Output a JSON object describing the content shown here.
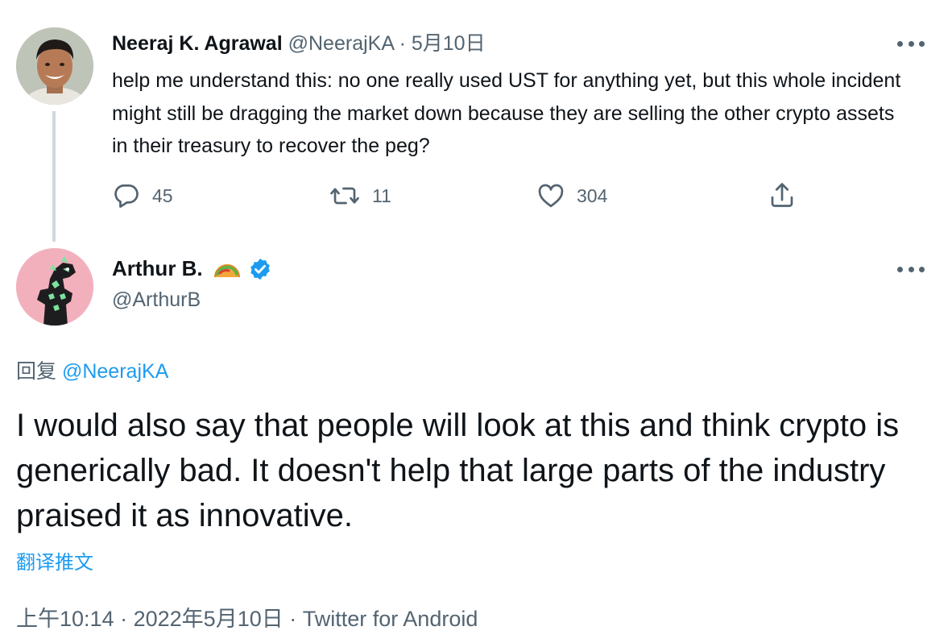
{
  "tweet1": {
    "name": "Neeraj K. Agrawal",
    "handle": "@NeerajKA",
    "separator": "·",
    "date": "5月10日",
    "text": "help me understand this: no one really used UST for anything yet, but this whole incident might still be dragging the market down because they are selling the other crypto assets in their treasury to recover the peg?",
    "reply_count": "45",
    "retweet_count": "11",
    "like_count": "304"
  },
  "tweet2": {
    "name": "Arthur B.",
    "name_emoji": "taco-icon",
    "verified_icon": "verified-badge-icon",
    "handle": "@ArthurB",
    "reply_prefix": "回复",
    "reply_to": "@NeerajKA",
    "text": "I would also say that people will look at this and think crypto is generically bad. It doesn't help that large parts of the industry praised it as innovative.",
    "translate_label": "翻译推文",
    "time": "上午10:14",
    "separator": "·",
    "date": "2022年5月10日",
    "source": "Twitter for Android"
  },
  "icons": {
    "reply": "reply-bubble-icon",
    "retweet": "retweet-icon",
    "like": "heart-icon",
    "share": "share-icon",
    "more": "more-dots-icon"
  },
  "colors": {
    "text": "#0f1419",
    "muted": "#536471",
    "link": "#1d9bf0",
    "thread_line": "#cfd9de",
    "verified": "#1d9bf0"
  }
}
